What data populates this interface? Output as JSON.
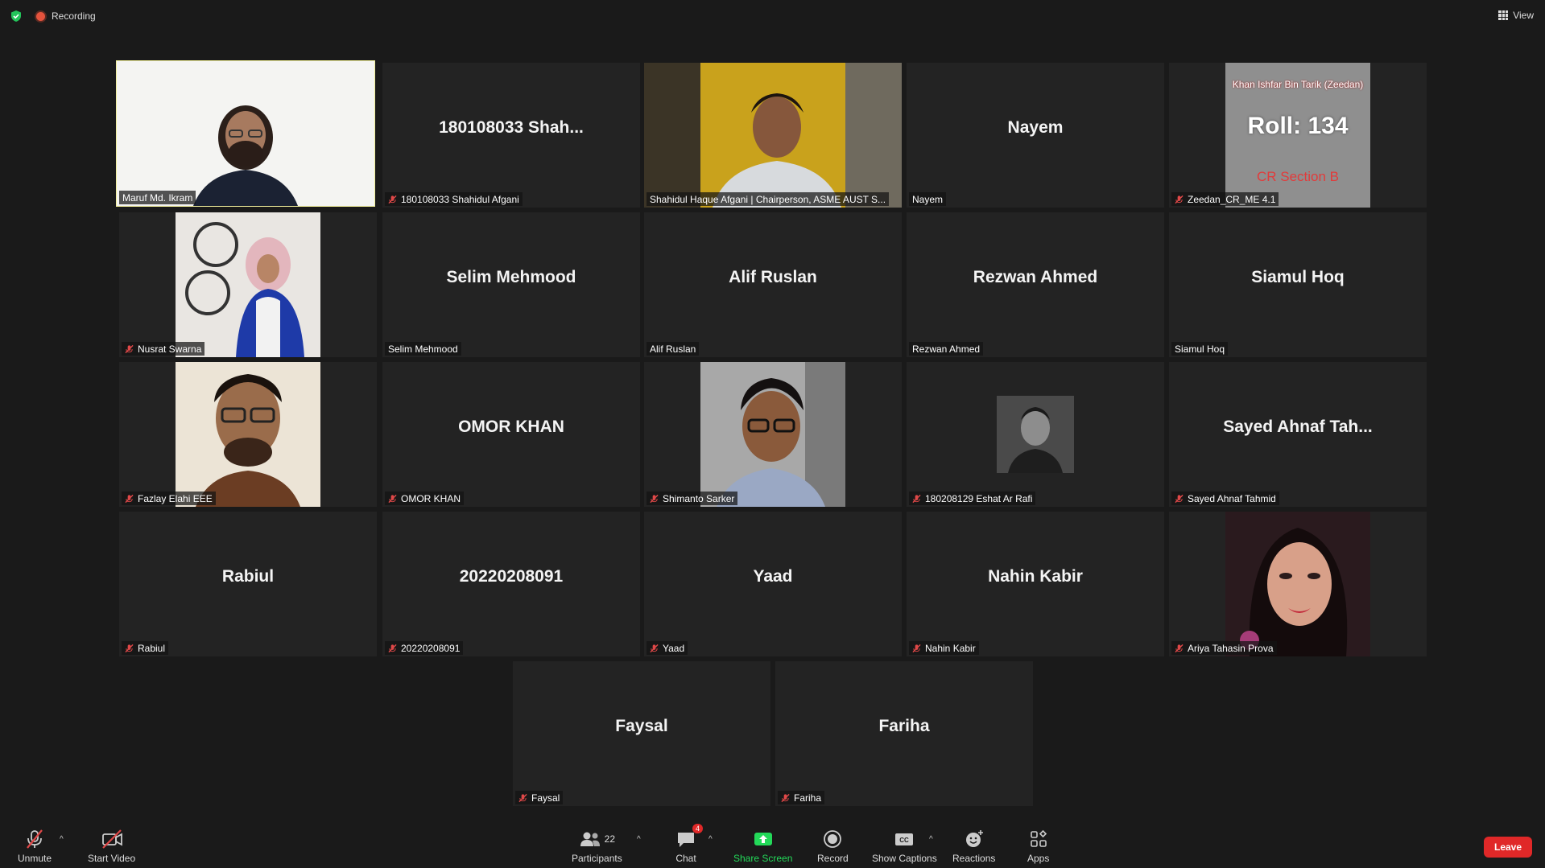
{
  "topbar": {
    "recording_label": "Recording",
    "view_label": "View"
  },
  "tiles": [
    {
      "big": "",
      "label": "Maruf Md. Ikram",
      "muted": false
    },
    {
      "big": "180108033  Shah...",
      "label": "180108033 Shahidul Afgani",
      "muted": true
    },
    {
      "big": "",
      "label": "Shahidul Haque Afgani | Chairperson, ASME AUST S...",
      "muted": false
    },
    {
      "big": "Nayem",
      "label": "Nayem",
      "muted": false
    },
    {
      "big": "",
      "label": "Zeedan_CR_ME 4.1",
      "muted": true
    },
    {
      "big": "",
      "label": "Nusrat Swarna",
      "muted": true
    },
    {
      "big": "Selim Mehmood",
      "label": "Selim Mehmood",
      "muted": false
    },
    {
      "big": "Alif Ruslan",
      "label": "Alif Ruslan",
      "muted": false
    },
    {
      "big": "Rezwan Ahmed",
      "label": "Rezwan Ahmed",
      "muted": false
    },
    {
      "big": "Siamul Hoq",
      "label": "Siamul Hoq",
      "muted": false
    },
    {
      "big": "",
      "label": "Fazlay Elahi EEE",
      "muted": true
    },
    {
      "big": "OMOR KHAN",
      "label": "OMOR KHAN",
      "muted": true
    },
    {
      "big": "",
      "label": "Shimanto Sarker",
      "muted": true
    },
    {
      "big": "",
      "label": "180208129 Eshat Ar Rafi",
      "muted": true
    },
    {
      "big": "Sayed  Ahnaf Tah...",
      "label": "Sayed Ahnaf Tahmid",
      "muted": true
    },
    {
      "big": "Rabiul",
      "label": "Rabiul",
      "muted": true
    },
    {
      "big": "20220208091",
      "label": "20220208091",
      "muted": true
    },
    {
      "big": "Yaad",
      "label": "Yaad",
      "muted": true
    },
    {
      "big": "Nahin Kabir",
      "label": "Nahin Kabir",
      "muted": true
    },
    {
      "big": "",
      "label": "Ariya Tahasin Prova",
      "muted": true
    },
    {
      "big": "Faysal",
      "label": "Faysal",
      "muted": true
    },
    {
      "big": "Fariha",
      "label": "Fariha",
      "muted": true
    }
  ],
  "zeedan_card": {
    "line1": "Khan Ishfar Bin Tarik (Zeedan)",
    "line2": "Roll: 134",
    "line3": "CR Section B"
  },
  "toolbar": {
    "unmute": "Unmute",
    "start_video": "Start Video",
    "participants": "Participants",
    "participants_count": "22",
    "chat": "Chat",
    "chat_badge": "4",
    "share_screen": "Share Screen",
    "record": "Record",
    "show_captions": "Show Captions",
    "reactions": "Reactions",
    "apps": "Apps",
    "leave": "Leave"
  },
  "colors": {
    "accent_green": "#23d959",
    "leave_red": "#e02828",
    "active_speaker": "#f0ee9a"
  }
}
